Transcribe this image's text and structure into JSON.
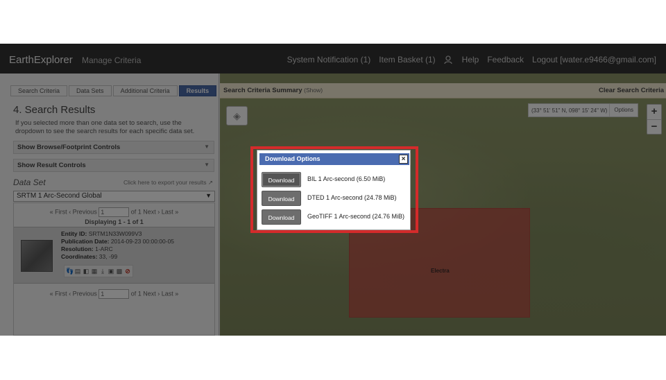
{
  "header": {
    "brand": "EarthExplorer",
    "manage": "Manage Criteria",
    "nav": [
      "System Notification (1)",
      "Item Basket (1)",
      "Help",
      "Feedback",
      "Logout [water.e9466@gmail.com]"
    ]
  },
  "left": {
    "tabs": [
      "Search Criteria",
      "Data Sets",
      "Additional Criteria",
      "Results"
    ],
    "title": "4. Search Results",
    "desc": "If you selected more than one data set to search, use the dropdown to see the search results for each specific data set.",
    "accordion1": "Show Browse/Footprint Controls",
    "accordion2": "Show Result Controls",
    "ds_label": "Data Set",
    "ds_export": "Click here to export your results",
    "ds_value": "SRTM 1 Arc-Second Global",
    "pager": {
      "first": "« First",
      "prev": "‹ Previous",
      "page": "1",
      "of": "of 1",
      "next": "Next ›",
      "last": "Last »"
    },
    "displaying": "Displaying 1 - 1 of 1",
    "result": {
      "entity": "SRTM1N33W099V3",
      "pubdate": "2014-09-23 00:00:00-05",
      "resolution": "1-ARC",
      "coordinates": "33, -99"
    }
  },
  "map": {
    "summary": "Search Criteria Summary",
    "show": "(Show)",
    "clear": "Clear Search Criteria",
    "coord": "(33° 51' 51\" N, 098° 15' 24\" W)",
    "options": "Options",
    "aoi_label": "Electra"
  },
  "modal": {
    "title": "Download Options",
    "close": "×",
    "options": [
      {
        "button": "Download",
        "label": "BIL 1 Arc-second (6.50 MiB)"
      },
      {
        "button": "Download",
        "label": "DTED 1 Arc-second (24.78 MiB)"
      },
      {
        "button": "Download",
        "label": "GeoTIFF 1 Arc-second (24.76 MiB)"
      }
    ]
  },
  "colors": {
    "accent": "#4a6bb0",
    "highlight": "#d42b2b",
    "aoi": "#c44e46"
  }
}
